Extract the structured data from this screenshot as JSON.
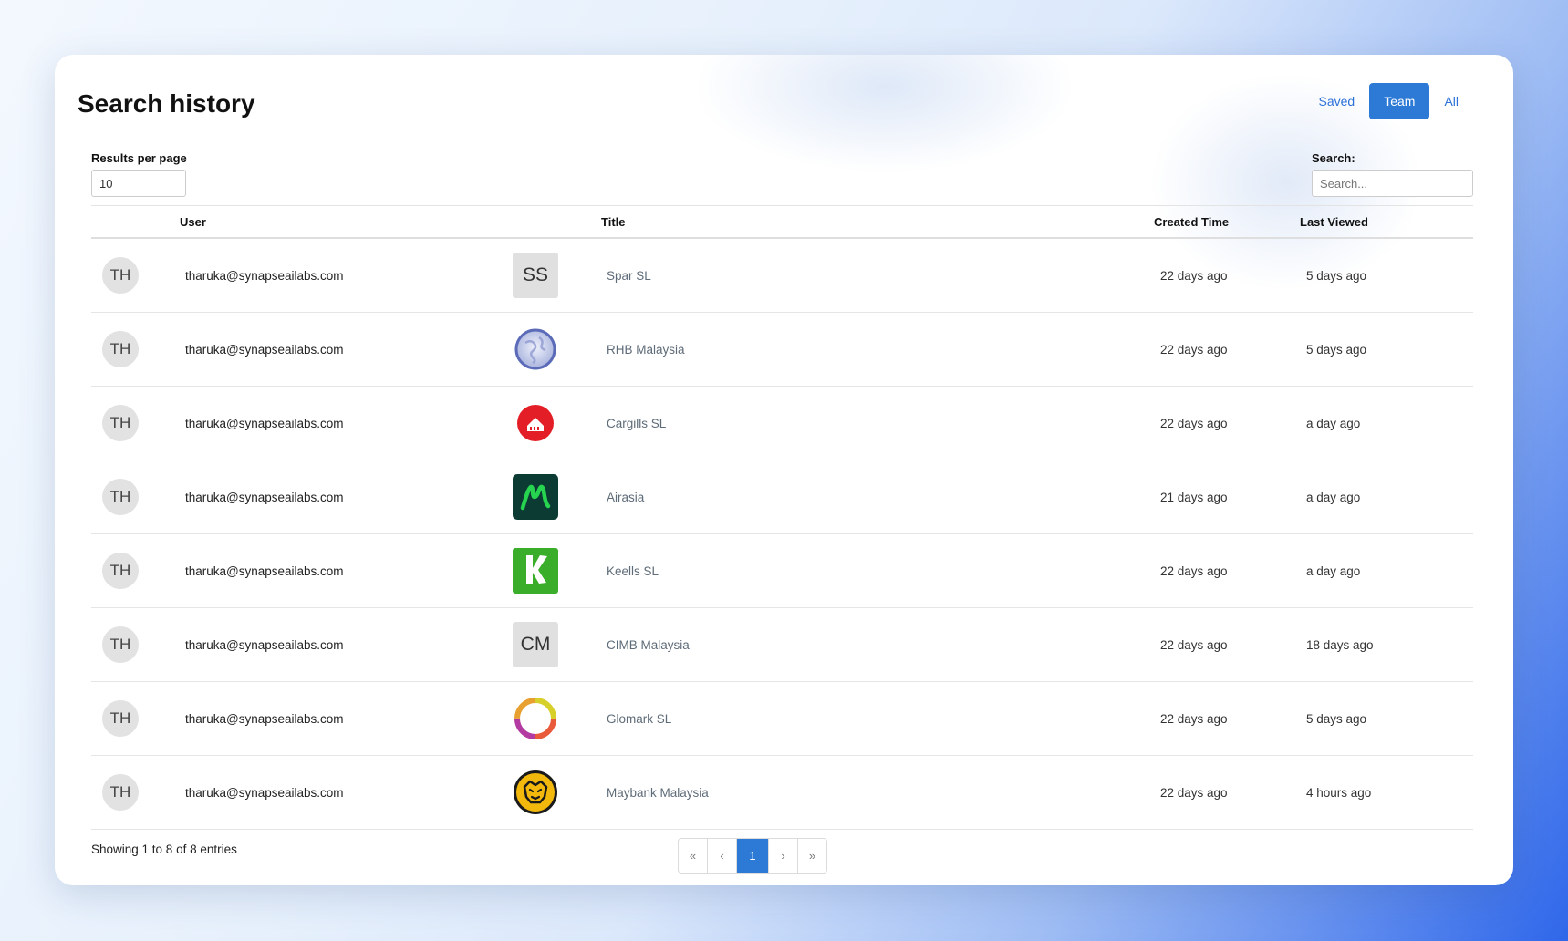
{
  "page": {
    "title": "Search history"
  },
  "filters": [
    {
      "label": "Saved",
      "active": false
    },
    {
      "label": "Team",
      "active": true
    },
    {
      "label": "All",
      "active": false
    }
  ],
  "controls": {
    "rpp_label": "Results per page",
    "rpp_value": "10",
    "search_label": "Search:",
    "search_placeholder": "Search..."
  },
  "table": {
    "headers": {
      "user": "User",
      "title": "Title",
      "created": "Created Time",
      "viewed": "Last Viewed"
    },
    "rows": [
      {
        "initials": "TH",
        "email": "tharuka@synapseailabs.com",
        "logo": "initials",
        "logo_text": "SS",
        "title": "Spar SL",
        "created": "22 days ago",
        "viewed": "5 days ago"
      },
      {
        "initials": "TH",
        "email": "tharuka@synapseailabs.com",
        "logo": "globe-icon",
        "logo_text": "",
        "title": "RHB Malaysia",
        "created": "22 days ago",
        "viewed": "5 days ago"
      },
      {
        "initials": "TH",
        "email": "tharuka@synapseailabs.com",
        "logo": "cargills-logo",
        "logo_text": "",
        "title": "Cargills SL",
        "created": "22 days ago",
        "viewed": "a day ago"
      },
      {
        "initials": "TH",
        "email": "tharuka@synapseailabs.com",
        "logo": "airasia-logo",
        "logo_text": "",
        "title": "Airasia",
        "created": "21 days ago",
        "viewed": "a day ago"
      },
      {
        "initials": "TH",
        "email": "tharuka@synapseailabs.com",
        "logo": "keells-logo",
        "logo_text": "",
        "title": "Keells SL",
        "created": "22 days ago",
        "viewed": "a day ago"
      },
      {
        "initials": "TH",
        "email": "tharuka@synapseailabs.com",
        "logo": "initials",
        "logo_text": "CM",
        "title": "CIMB Malaysia",
        "created": "22 days ago",
        "viewed": "18 days ago"
      },
      {
        "initials": "TH",
        "email": "tharuka@synapseailabs.com",
        "logo": "glomark-logo",
        "logo_text": "",
        "title": "Glomark SL",
        "created": "22 days ago",
        "viewed": "5 days ago"
      },
      {
        "initials": "TH",
        "email": "tharuka@synapseailabs.com",
        "logo": "maybank-logo",
        "logo_text": "",
        "title": "Maybank Malaysia",
        "created": "22 days ago",
        "viewed": "4 hours ago"
      }
    ]
  },
  "footer": {
    "showing": "Showing 1 to 8 of 8 entries",
    "pager": {
      "first": "«",
      "prev": "‹",
      "current": "1",
      "next": "›",
      "last": "»"
    }
  },
  "colors": {
    "accent": "#2d7ad6",
    "title_text": "#5e6b78"
  }
}
